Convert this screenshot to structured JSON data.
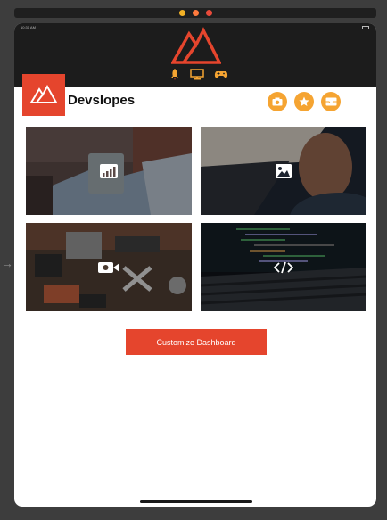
{
  "app": {
    "title": "Devslopes",
    "status_time": "10:31 AM"
  },
  "header": {
    "nav_icons": [
      "rocket-icon",
      "monitor-icon",
      "gamepad-icon"
    ]
  },
  "toolbar": {
    "buttons": [
      "camera-icon",
      "star-icon",
      "inbox-icon"
    ]
  },
  "cards": [
    {
      "icon": "chart-icon",
      "theme": "analytics"
    },
    {
      "icon": "image-icon",
      "theme": "photos"
    },
    {
      "icon": "video-camera-icon",
      "theme": "video"
    },
    {
      "icon": "code-icon",
      "theme": "code"
    }
  ],
  "actions": {
    "customize_label": "Customize Dashboard"
  },
  "colors": {
    "brand_red": "#e5452d",
    "accent_orange": "#f5a432",
    "header_dark": "#1c1c1c"
  }
}
